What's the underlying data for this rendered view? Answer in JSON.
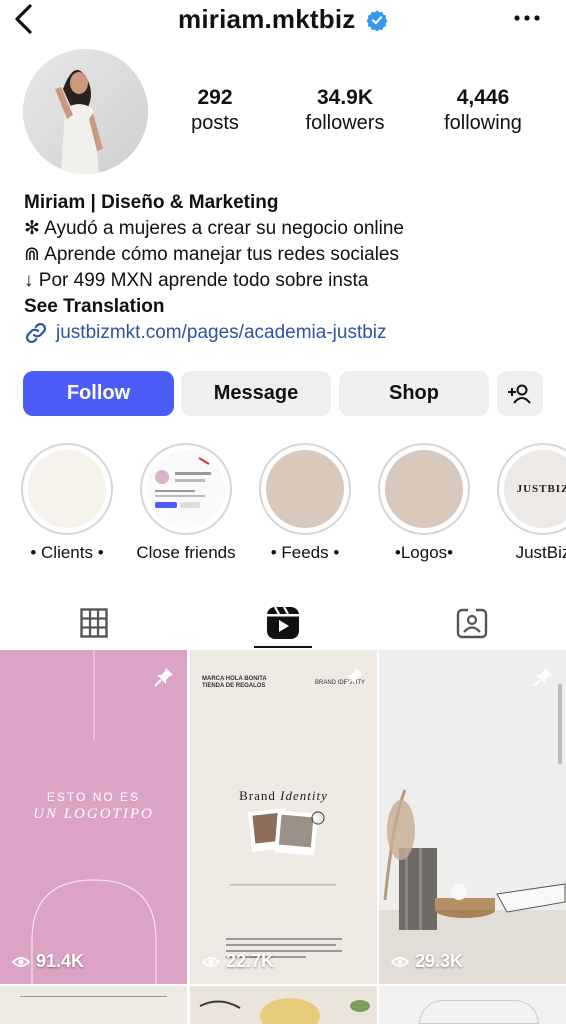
{
  "header": {
    "username": "miriam.mktbiz"
  },
  "stats": [
    {
      "value": "292",
      "label": "posts"
    },
    {
      "value": "34.9K",
      "label": "followers"
    },
    {
      "value": "4,446",
      "label": "following"
    }
  ],
  "bio": {
    "name": "Miriam | Diseño & Marketing",
    "lines": [
      "✻ Ayudó a mujeres a crear su negocio online",
      "⋒ Aprende cómo manejar tus redes sociales",
      "↓ Por 499 MXN aprende todo sobre insta"
    ],
    "translate": "See Translation",
    "link": "justbizmkt.com/pages/academia-justbiz"
  },
  "buttons": {
    "follow": "Follow",
    "message": "Message",
    "shop": "Shop"
  },
  "highlights": [
    {
      "label": "• Clients •",
      "color": "#f6f2ec"
    },
    {
      "label": "Close friends",
      "color": "#ffffff"
    },
    {
      "label": "• Feeds •",
      "color": "#d9c9bd"
    },
    {
      "label": "•Logos•",
      "color": "#d9c9bd"
    },
    {
      "label": "JustBiz",
      "color": "#ece9e6",
      "logo_text": "JUSTBIZ"
    }
  ],
  "tiles": [
    {
      "views": "91.4K",
      "line1": "ESTO NO ES",
      "line2": "UN LOGOTIPO",
      "color": "#dca4c4"
    },
    {
      "views": "22.7K",
      "header_left": "MARCA HOLA BONITA",
      "header_left2": "TIENDA DE REGALOS",
      "header_right": "BRAND IDENTITY",
      "title_a": "Brand",
      "title_b": "Identity",
      "color": "#efe9e4"
    },
    {
      "views": "29.3K",
      "color": "#eeeeec"
    }
  ],
  "colors": {
    "accent": "#4a5df7",
    "link": "#2f52a6",
    "verified": "#3897f0"
  }
}
